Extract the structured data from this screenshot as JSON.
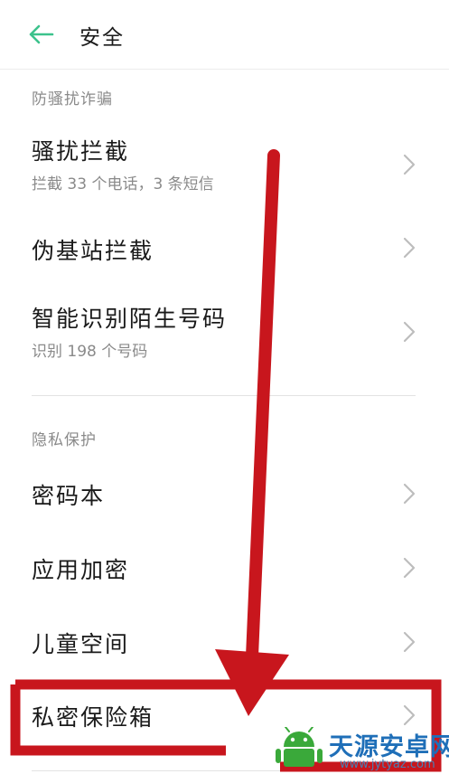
{
  "header": {
    "title": "安全",
    "back_icon": "arrow-left-icon",
    "accent": "#3cc28c"
  },
  "sections": [
    {
      "label": "防骚扰诈骗",
      "items": [
        {
          "title": "骚扰拦截",
          "subtitle": "拦截 33 个电话，3 条短信"
        },
        {
          "title": "伪基站拦截"
        },
        {
          "title": "智能识别陌生号码",
          "subtitle": "识别 198 个号码"
        }
      ]
    },
    {
      "label": "隐私保护",
      "items": [
        {
          "title": "密码本"
        },
        {
          "title": "应用加密"
        },
        {
          "title": "儿童空间"
        },
        {
          "title": "私密保险箱"
        }
      ]
    }
  ],
  "annotation": {
    "color": "#c8161d",
    "highlighted_item": "私密保险箱"
  },
  "watermark": {
    "name": "天源安卓网",
    "url": "www.jytyaz.com",
    "colors": [
      "#1f6fb8",
      "#3aa93a"
    ]
  }
}
